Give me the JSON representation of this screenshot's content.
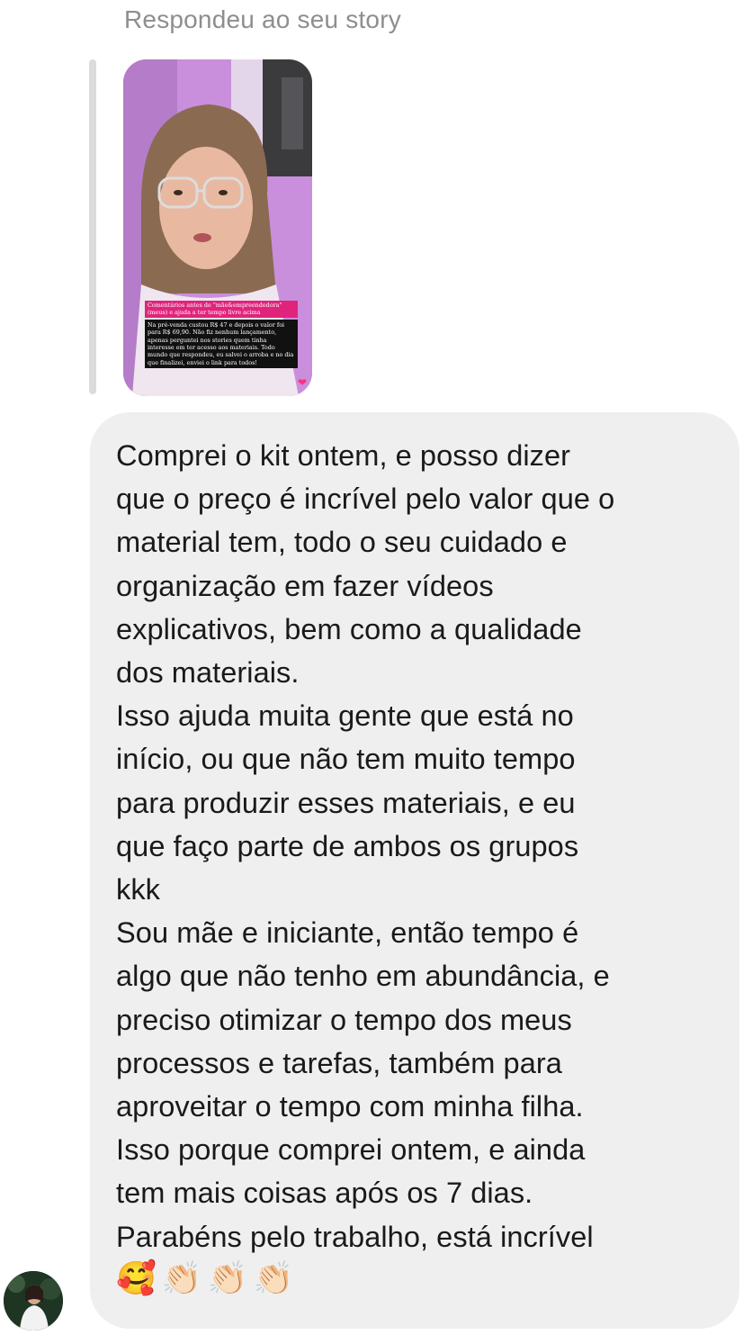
{
  "header": {
    "reply_label": "Respondeu ao seu story"
  },
  "story": {
    "caption_pink": "Comentários antes de \"mãe&empreendedora\" (meus) e ajuda a ter tempo livre acima",
    "caption_dark": "Na pré-venda custou R$ 47 e depois o valor foi para R$ 69,90. Não fiz nenhum lançamento, apenas perguntei nos stories quem tinha interesse em ter acesso aos materiais. Todo mundo que respondeu, eu salvei o arroba e no dia que finalizei, enviei o link para todos!",
    "colors": {
      "wall": "#c58fd6",
      "caption_pink": "#e0247c",
      "caption_dark": "#111111"
    }
  },
  "message": {
    "lines": [
      "Comprei o kit ontem, e posso dizer",
      "que o preço é incrível pelo valor que o",
      "material tem, todo o seu cuidado e",
      "organização em fazer vídeos",
      "explicativos, bem como a qualidade",
      "dos materiais.",
      "Isso ajuda muita gente que está no",
      "início, ou que não tem muito tempo",
      "para produzir esses materiais, e eu",
      "que faço parte de ambos os grupos",
      "kkk",
      "Sou mãe e iniciante, então tempo é",
      "algo que não tenho em abundância, e",
      "preciso otimizar o tempo dos meus",
      "processos e tarefas, também para",
      "aproveitar o tempo com minha filha.",
      "Isso porque comprei ontem, e ainda",
      "tem mais coisas após os 7 dias.",
      "Parabéns pelo trabalho, está incrível"
    ],
    "emojis": [
      "🥰",
      "👏🏻",
      "👏🏻",
      "👏🏻"
    ],
    "bubble_color": "#efefef"
  },
  "avatar": {
    "icon": "user-avatar"
  }
}
